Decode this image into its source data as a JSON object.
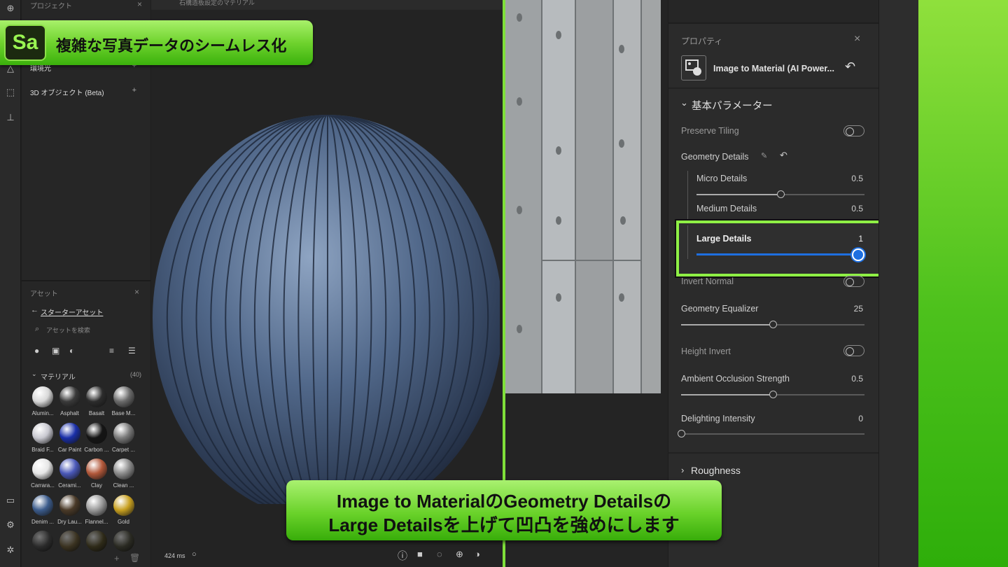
{
  "left_panel": {
    "project_header": "プロジェクト",
    "tree": [
      {
        "label": "環境光"
      },
      {
        "label": "3D オブジェクト (Beta)"
      }
    ],
    "assets_header": "アセット",
    "back_link": "スターターアセット",
    "search_placeholder": "アセットを検索",
    "section_label": "マテリアル",
    "section_count": "(40)",
    "materials": [
      {
        "label": "Alumin...",
        "color": "#d8d8d8"
      },
      {
        "label": "Asphalt",
        "color": "#3a3a3a"
      },
      {
        "label": "Basalt",
        "color": "#2c2c2c"
      },
      {
        "label": "Base M...",
        "color": "#6a6a6a"
      },
      {
        "label": "Braid F...",
        "color": "#c8c8d0"
      },
      {
        "label": "Car Paint",
        "color": "#1a2fa8"
      },
      {
        "label": "Carbon ...",
        "color": "#151515"
      },
      {
        "label": "Carpet ...",
        "color": "#7a7a7a"
      },
      {
        "label": "Carrara...",
        "color": "#e6e6e6"
      },
      {
        "label": "Cerami...",
        "color": "#4a58b8"
      },
      {
        "label": "Clay",
        "color": "#b2583a"
      },
      {
        "label": "Clean ...",
        "color": "#8a8a8a"
      },
      {
        "label": "Denim ...",
        "color": "#3c5c8c"
      },
      {
        "label": "Dry Lau...",
        "color": "#4a3a28"
      },
      {
        "label": "Flannel...",
        "color": "#9a9a9a"
      },
      {
        "label": "Gold",
        "color": "#c8a020"
      }
    ]
  },
  "viewport": {
    "title": "石構造板設定のマテリアル",
    "render_time": "424 ms"
  },
  "properties": {
    "header": "プロパティ",
    "node_title": "Image to Material (AI Power...",
    "section_basic": "基本パラメーター",
    "preserve_tiling": "Preserve Tiling",
    "geometry_details": "Geometry Details",
    "micro_details": {
      "label": "Micro Details",
      "value": "0.5",
      "fraction": 0.5
    },
    "medium_details": {
      "label": "Medium Details",
      "value": "0.5",
      "fraction": 0.5
    },
    "large_details": {
      "label": "Large Details",
      "value": "1",
      "fraction": 1.0
    },
    "invert_normal": "Invert Normal",
    "geometry_equalizer": {
      "label": "Geometry Equalizer",
      "value": "25",
      "fraction": 0.5
    },
    "height_invert": "Height Invert",
    "ao_strength": {
      "label": "Ambient Occlusion Strength",
      "value": "0.5",
      "fraction": 0.5
    },
    "delighting": {
      "label": "Delighting Intensity",
      "value": "0",
      "fraction": 0.0
    },
    "section_roughness": "Roughness"
  },
  "overlay": {
    "logo": "Sa",
    "banner": "複雑な写真データのシームレス化",
    "caption_line1": "Image to MaterialのGeometry Detailsの",
    "caption_line2": "Large Detailsを上げて凹凸を強めにします"
  },
  "colors": {
    "accent_green": "#8ff045",
    "slider_blue": "#1e6fe0"
  }
}
